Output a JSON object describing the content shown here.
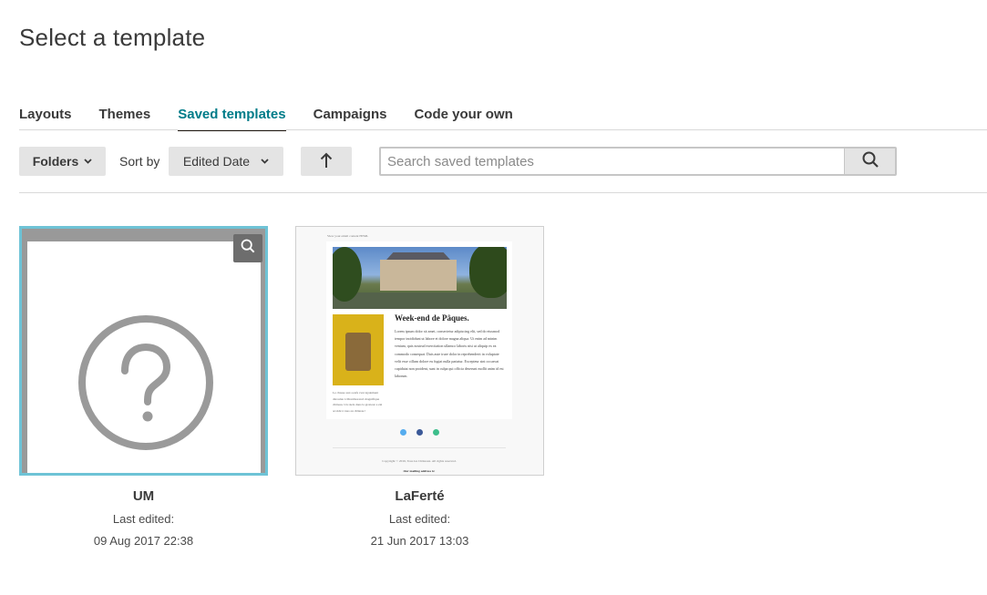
{
  "page": {
    "title": "Select a template"
  },
  "tabs": [
    {
      "label": "Layouts",
      "active": false
    },
    {
      "label": "Themes",
      "active": false
    },
    {
      "label": "Saved templates",
      "active": true
    },
    {
      "label": "Campaigns",
      "active": false
    },
    {
      "label": "Code your own",
      "active": false
    }
  ],
  "toolbar": {
    "folders_label": "Folders",
    "sort_by_label": "Sort by",
    "sort_value": "Edited Date",
    "sort_direction_icon": "arrow-up-icon",
    "search_placeholder": "Search saved templates",
    "search_icon": "search-icon"
  },
  "templates": [
    {
      "name": "UM",
      "meta": "Last edited:",
      "date": "09 Aug 2017 22:38",
      "thumbnail": "question-mark-icon",
      "selected": true
    },
    {
      "name": "LaFerté",
      "meta": "Last edited:",
      "date": "21 Jun 2017 13:03",
      "thumbnail": "email-preview",
      "selected": false,
      "preview": {
        "top_link": "View your email content HTML",
        "heading": "Week-end de Pâques.",
        "body": "Lorem ipsum dolor sit amet, consectetur adipiscing elit, sed do eiusmod tempor incididunt ut labore et dolore magna aliqua. Ut enim ad minim veniam, quis nostrud exercitation ullamco laboris nisi ut aliquip ex ea commodo consequat. Duis aute irure dolor in reprehenderit in voluptate velit esse cillum dolore eu fugiat nulla pariatur. Excepteur sint occaecat cupidatat non proident, sunt in culpa qui officia deserunt mollit anim id est laborum.",
        "caption": "Le chasse aux oeufs s'est également déroulée à Montmorenci magnifique château. Un réels dans la grotteur a été accédé à tous au château !",
        "copyright": "Copyright © 2016, Tous les Châteaux. All rights reserved.",
        "address": "Our mailing address is:"
      }
    }
  ],
  "colors": {
    "accent": "#007c89",
    "selected_border": "#6ec3d6",
    "button_bg": "#e4e4e4"
  }
}
